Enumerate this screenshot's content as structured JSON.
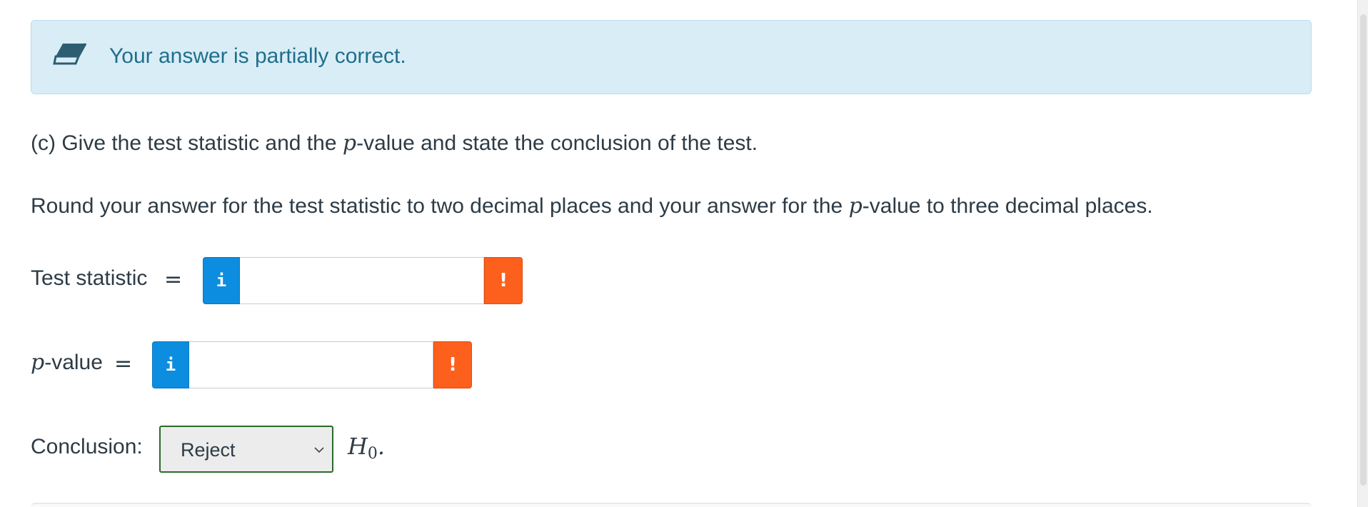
{
  "alert": {
    "message": "Your answer is partially correct.",
    "icon": "eraser-icon",
    "background": "#d9edf7",
    "text_color": "#1f6f8b"
  },
  "question": {
    "part_prefix": "(c) Give the test statistic and the ",
    "p_symbol": "p",
    "part_suffix": "-value and state the conclusion of the test.",
    "round_prefix": "Round your answer for the test statistic to two decimal places and your answer for the ",
    "round_suffix": "-value to three decimal places."
  },
  "test_statistic": {
    "label": "Test statistic",
    "equals": "=",
    "info_glyph": "i",
    "value": "",
    "warning_glyph": "!"
  },
  "p_value": {
    "label_symbol": "p",
    "label_suffix": "-value",
    "equals": "=",
    "info_glyph": "i",
    "value": "",
    "warning_glyph": "!"
  },
  "conclusion": {
    "label": "Conclusion:",
    "selected": "Reject",
    "hypothesis_symbol": "H",
    "hypothesis_subscript": "0",
    "trailing": "."
  },
  "colors": {
    "info_button": "#0d8de0",
    "warning_button": "#fd5f1d",
    "select_border": "#2b6a2b"
  }
}
